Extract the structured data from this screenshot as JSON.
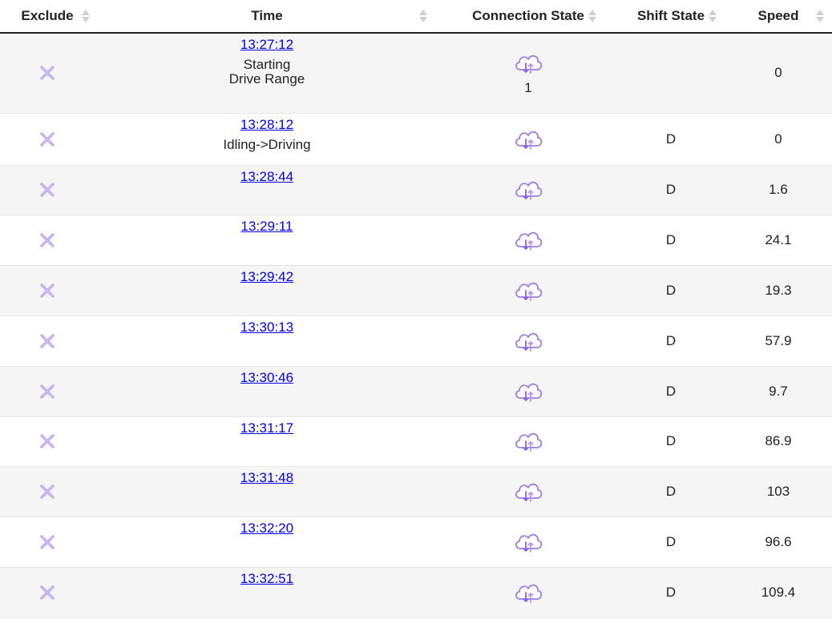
{
  "columns": {
    "exclude": "Exclude",
    "time": "Time",
    "connection_state": "Connection State",
    "shift_state": "Shift State",
    "speed": "Speed"
  },
  "icons": {
    "exclude": "x-mark-icon",
    "connection": "cloud-sync-icon",
    "sort": "sort-arrows-icon",
    "accent": "#a88cf0"
  },
  "rows": [
    {
      "time": "13:27:12",
      "note": [
        "Starting",
        "Drive Range"
      ],
      "conn": "1",
      "shift": "",
      "speed": "0"
    },
    {
      "time": "13:28:12",
      "note": [
        "Idling->Driving"
      ],
      "conn": "",
      "shift": "D",
      "speed": "0"
    },
    {
      "time": "13:28:44",
      "note": [],
      "conn": "",
      "shift": "D",
      "speed": "1.6"
    },
    {
      "time": "13:29:11",
      "note": [],
      "conn": "",
      "shift": "D",
      "speed": "24.1"
    },
    {
      "time": "13:29:42",
      "note": [],
      "conn": "",
      "shift": "D",
      "speed": "19.3"
    },
    {
      "time": "13:30:13",
      "note": [],
      "conn": "",
      "shift": "D",
      "speed": "57.9"
    },
    {
      "time": "13:30:46",
      "note": [],
      "conn": "",
      "shift": "D",
      "speed": "9.7"
    },
    {
      "time": "13:31:17",
      "note": [],
      "conn": "",
      "shift": "D",
      "speed": "86.9"
    },
    {
      "time": "13:31:48",
      "note": [],
      "conn": "",
      "shift": "D",
      "speed": "103"
    },
    {
      "time": "13:32:20",
      "note": [],
      "conn": "",
      "shift": "D",
      "speed": "96.6"
    },
    {
      "time": "13:32:51",
      "note": [],
      "conn": "",
      "shift": "D",
      "speed": "109.4"
    }
  ]
}
